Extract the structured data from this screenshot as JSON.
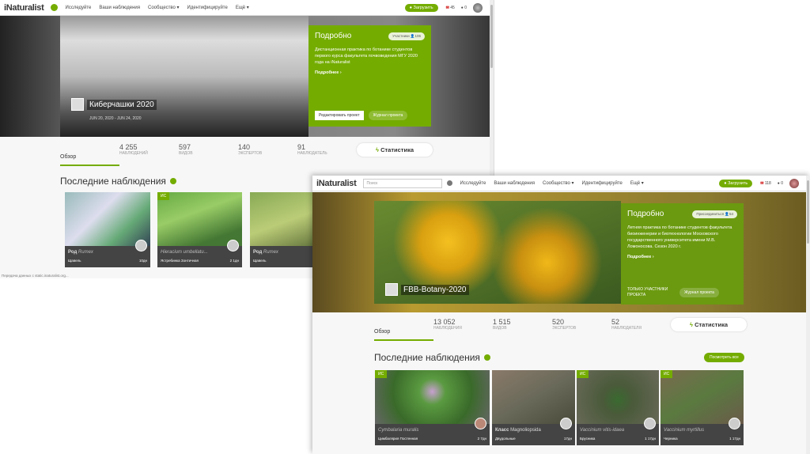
{
  "window1": {
    "nav": {
      "logo": "iNaturalist",
      "items": [
        "Исследуйте",
        "Ваши наблюдения",
        "Сообщество ▾",
        "Идентифицируйте",
        "Ещё ▾"
      ],
      "upload": "Загрузить",
      "messages": "45",
      "notifications": "0"
    },
    "project": {
      "title": "Киберчашки 2020",
      "dates": "JUN 20, 2020 - JUN 24, 2020",
      "panel_title": "Подробно",
      "members_label": "Участники",
      "members_count": "106",
      "description": "Дистанционная практика по ботанике студентов первого курса факультета почвоведения МГУ 2020 года на iNaturalist",
      "more": "Подробнее ›",
      "edit": "Редактировать проект",
      "journal": "Журнал проекта"
    },
    "stats": {
      "tab": "Обзор",
      "items": [
        {
          "n": "4 255",
          "l": "НАБЛЮДЕНИЙ"
        },
        {
          "n": "597",
          "l": "ВИДОВ"
        },
        {
          "n": "140",
          "l": "ЭКСПЕРТОВ"
        },
        {
          "n": "91",
          "l": "НАБЛЮДАТЕЛЬ"
        }
      ],
      "button": "Статистика"
    },
    "heading": "Последние наблюдения",
    "cards": [
      {
        "rank": "Род",
        "name": "Rumex",
        "common": "Щавель",
        "meta": "10дн"
      },
      {
        "badge": "ИС",
        "rank": "",
        "name": "Hieracium umbellatu...",
        "common": "Ястребинка Зонтичная",
        "meta": "2 1дн"
      },
      {
        "rank": "Род",
        "name": "Rumex",
        "common": "Щавель",
        "meta": ""
      }
    ],
    "status": "Передача данных с static.inaturalist.org..."
  },
  "window2": {
    "nav": {
      "logo": "iNaturalist",
      "search_placeholder": "Поиск",
      "items": [
        "Исследуйте",
        "Ваши наблюдения",
        "Сообщество ▾",
        "Идентифицируйте",
        "Ещё ▾"
      ],
      "upload": "Загрузить",
      "messages": "118",
      "notifications": "0"
    },
    "project": {
      "title": "FBB-Botany-2020",
      "panel_title": "Подробно",
      "join": "Присоединиться",
      "members_count": "54",
      "description": "Летняя практика по ботанике студентов факультета биоинженерии и биотехнологии Московского государственного университета имени М.В. Ломоносова. Сезон 2020 г.",
      "more": "Подробнее ›",
      "members_only": "ТОЛЬКО УЧАСТНИКИ ПРОЕКТА",
      "journal": "Журнал проекта"
    },
    "stats": {
      "tab": "Обзор",
      "items": [
        {
          "n": "13 052",
          "l": "НАБЛЮДЕНИЯ"
        },
        {
          "n": "1 515",
          "l": "ВИДОВ"
        },
        {
          "n": "520",
          "l": "ЭКСПЕРТОВ"
        },
        {
          "n": "52",
          "l": "НАБЛЮДАТЕЛЯ"
        }
      ],
      "button": "Статистика"
    },
    "heading": "Последние наблюдения",
    "view_all": "Посмотреть все",
    "cards": [
      {
        "badge": "ИС",
        "rank": "",
        "name": "Cymbalaria muralis",
        "common": "Цимбалярия Постенная",
        "meta": "2 7дн"
      },
      {
        "badge": "",
        "rank": "Класс",
        "name": "Magnoliopsida",
        "common": "Двудольные",
        "meta": "17дн"
      },
      {
        "badge": "ИС",
        "rank": "",
        "name": "Vaccinium vitis-idaea",
        "common": "Брусника",
        "meta": "1 17дн"
      },
      {
        "badge": "ИС",
        "rank": "",
        "name": "Vaccinium myrtillus",
        "common": "Черника",
        "meta": "1 17дн"
      }
    ]
  },
  "colors": {
    "accent": "#74ac00",
    "panel2": "#6b9a10"
  }
}
